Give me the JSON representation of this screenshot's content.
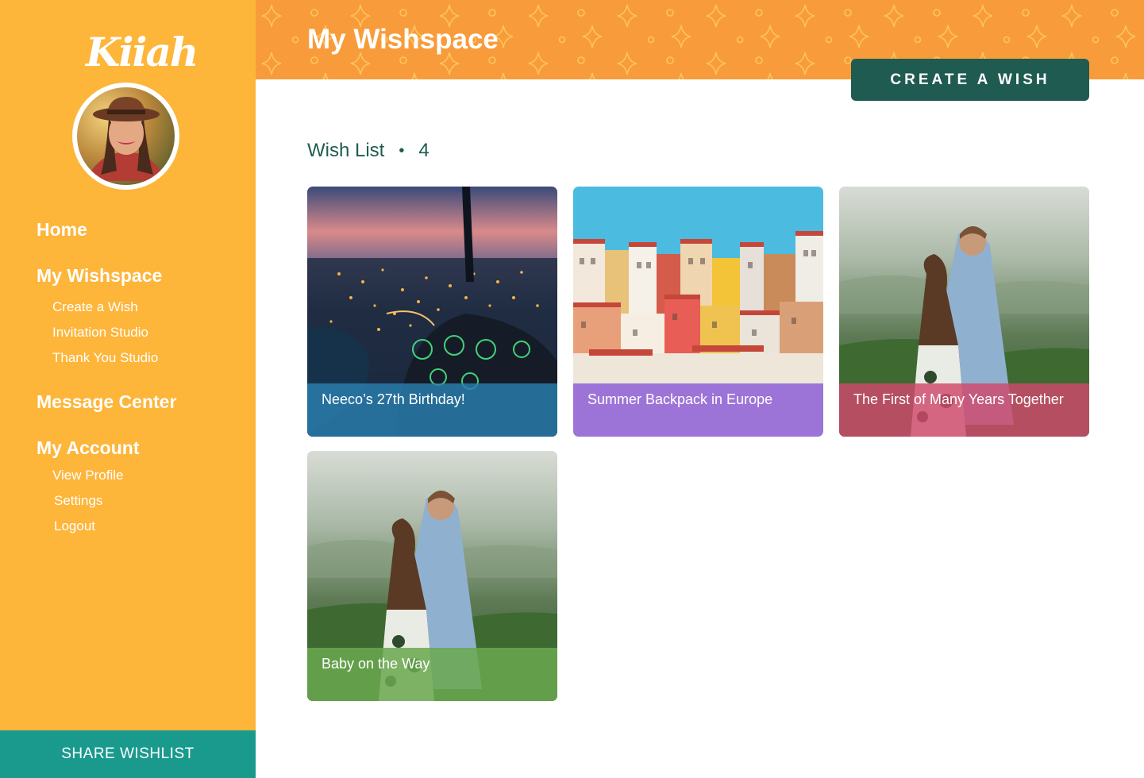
{
  "sidebar": {
    "logo": "Kiiah",
    "nav": {
      "home": "Home",
      "wishspace": "My Wishspace",
      "create_wish": "Create a Wish",
      "invitation_studio": "Invitation Studio",
      "thank_you_studio": "Thank You Studio",
      "message_center": "Message Center",
      "my_account": "My Account",
      "view_profile": "View Profile",
      "settings": "Settings",
      "logout": "Logout"
    },
    "share_button": "SHARE WISHLIST"
  },
  "header": {
    "title": "My Wishspace",
    "create_button": "CREATE A WISH"
  },
  "wishlist": {
    "label": "Wish List",
    "separator": "•",
    "count": "4",
    "cards": [
      {
        "title": "Neeco’s 27th Birthday!",
        "overlay_color": "#2a7fb0",
        "photo": "city-night-helicopter"
      },
      {
        "title": "Summer Backpack in Europe",
        "overlay_color": "#8a5ad6",
        "photo": "european-town"
      },
      {
        "title": "The First of Many Years Together",
        "overlay_color": "#d0486b",
        "photo": "couple-valley"
      },
      {
        "title": "Baby on the Way",
        "overlay_color": "#6aa84f",
        "photo": "couple-valley"
      }
    ]
  },
  "colors": {
    "sidebar": "#fdb53a",
    "header": "#f89c3b",
    "primary_dark": "#1f5b51",
    "share": "#199a8d"
  }
}
